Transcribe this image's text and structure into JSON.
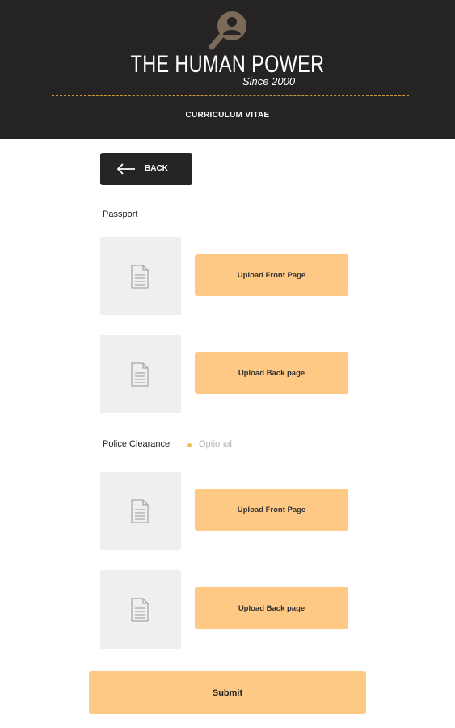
{
  "header": {
    "brand": "THE HUMAN POWER",
    "since": "Since 2000",
    "title": "CURRICULUM VITAE",
    "logo_icon": "magnifier-person-icon",
    "accent": "#c89a3c",
    "background": "#262325"
  },
  "back": {
    "label": "BACK",
    "icon": "arrow-left-icon"
  },
  "passport": {
    "label": "Passport",
    "front_button": "Upload Front Page",
    "back_button": "Upload Back page",
    "placeholder_icon": "document-icon"
  },
  "police": {
    "label": "Police Clearance",
    "optional": "Optional",
    "front_button": "Upload Front Page",
    "back_button": "Upload Back page",
    "placeholder_icon": "document-icon"
  },
  "submit": {
    "label": "Submit"
  },
  "colors": {
    "button": "#fec885",
    "thumb": "#efefef",
    "optional_dot": "#f5b95a"
  }
}
